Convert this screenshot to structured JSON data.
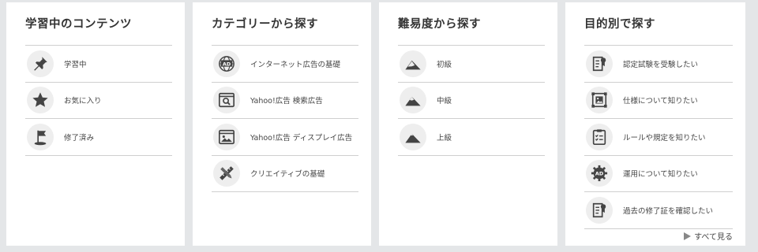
{
  "colors": {
    "icon": "#444444",
    "icon_bg": "#eeeeee",
    "divider": "#cfcfcf",
    "background": "#e4e6e8"
  },
  "panels": [
    {
      "title": "学習中のコンテンツ",
      "items": [
        {
          "label": "学習中",
          "icon": "pushpin-icon"
        },
        {
          "label": "お気に入り",
          "icon": "star-icon"
        },
        {
          "label": "修了済み",
          "icon": "flag-icon"
        }
      ]
    },
    {
      "title": "カテゴリーから探す",
      "items": [
        {
          "label": "インターネット広告の基礎",
          "icon": "ad-globe-icon"
        },
        {
          "label": "Yahoo!広告 検索広告",
          "icon": "search-window-icon"
        },
        {
          "label": "Yahoo!広告 ディスプレイ広告",
          "icon": "image-icon"
        },
        {
          "label": "クリエイティブの基礎",
          "icon": "pencil-ruler-icon"
        }
      ]
    },
    {
      "title": "難易度から探す",
      "items": [
        {
          "label": "初級",
          "icon": "mountain-beginner-icon"
        },
        {
          "label": "中級",
          "icon": "mountain-intermediate-icon"
        },
        {
          "label": "上級",
          "icon": "mountain-advanced-icon"
        }
      ]
    },
    {
      "title": "目的別で探す",
      "items": [
        {
          "label": "認定試験を受験したい",
          "icon": "certificate-icon"
        },
        {
          "label": "仕様について知りたい",
          "icon": "spec-icon"
        },
        {
          "label": "ルールや規定を知りたい",
          "icon": "clipboard-icon"
        },
        {
          "label": "運用について知りたい",
          "icon": "ad-gear-icon"
        },
        {
          "label": "過去の修了証を確認したい",
          "icon": "document-ribbon-icon"
        }
      ],
      "see_all": "すべて見る"
    }
  ]
}
